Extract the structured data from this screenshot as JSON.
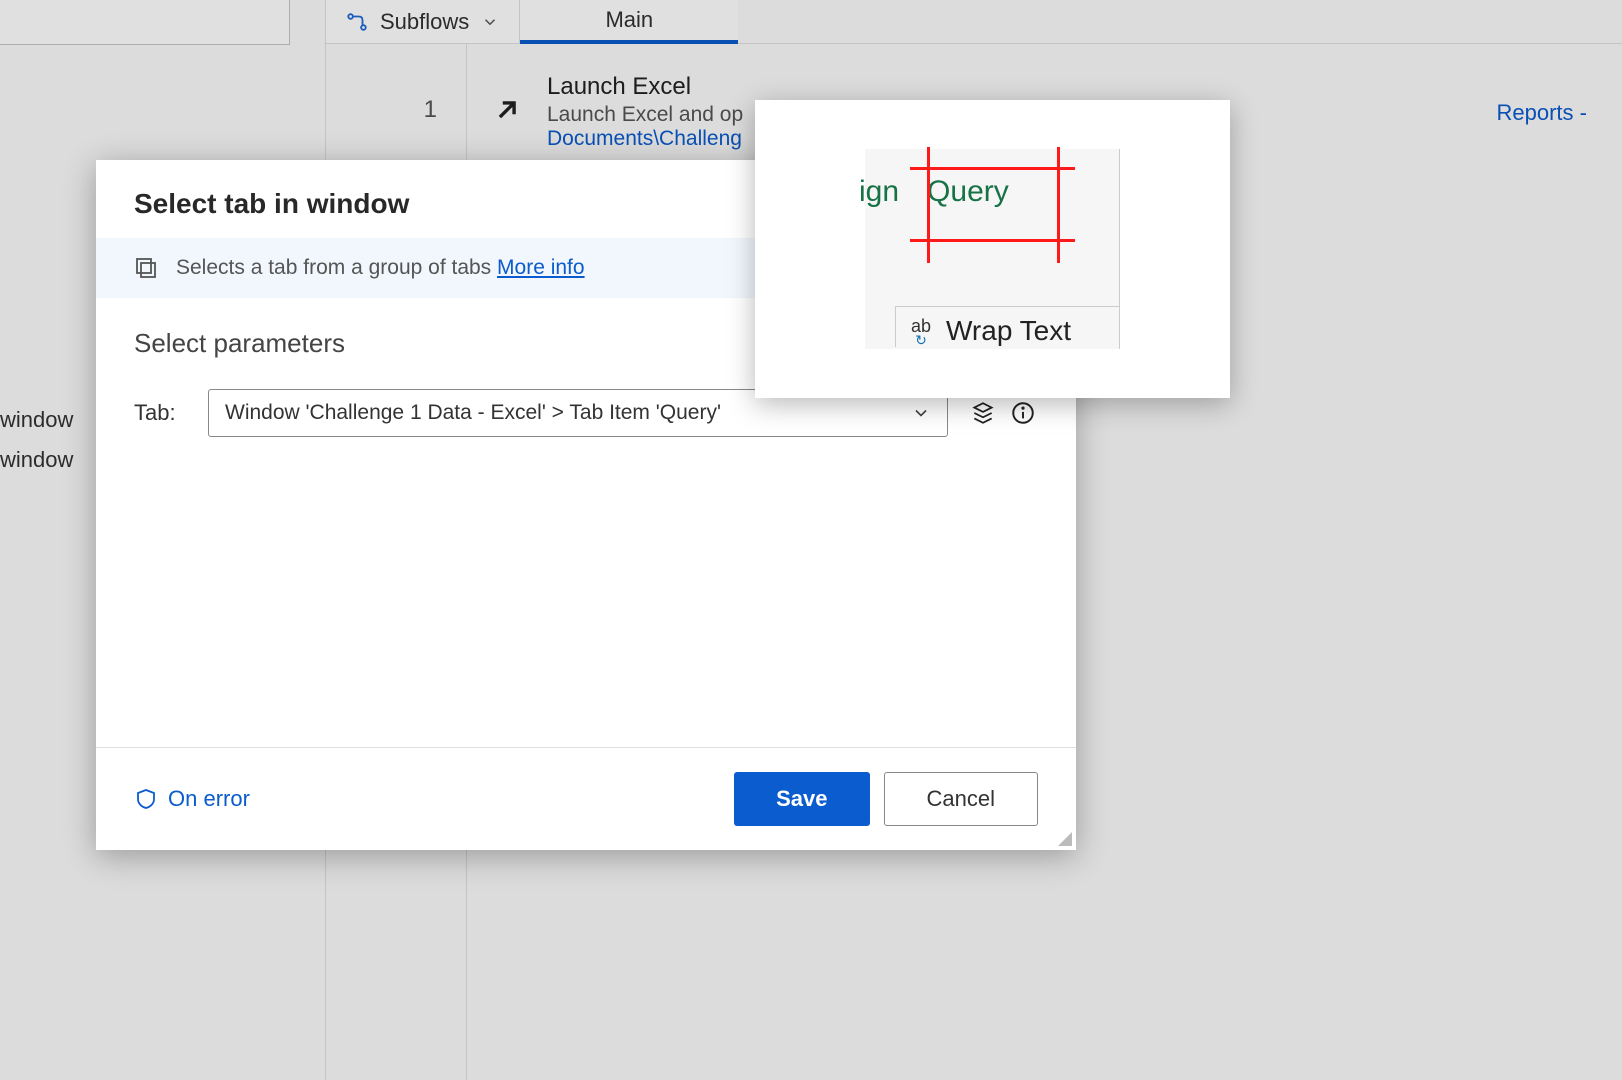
{
  "toolbar": {
    "subflows_label": "Subflows",
    "main_tab_label": "Main"
  },
  "step": {
    "number": "1",
    "title": "Launch Excel",
    "desc": "Launch Excel and op",
    "path": "Documents\\Challeng",
    "reports_link": "Reports -"
  },
  "side": {
    "line1": "window",
    "line2": "window"
  },
  "dialog": {
    "title": "Select tab in window",
    "description": "Selects a tab from a group of tabs",
    "more_info": "More info",
    "section_header": "Select parameters",
    "param_label": "Tab:",
    "param_value": "Window 'Challenge 1 Data - Excel' > Tab Item 'Query'",
    "on_error_label": "On error",
    "save_label": "Save",
    "cancel_label": "Cancel"
  },
  "preview": {
    "tab_partial": "ign",
    "tab_highlighted": "Query",
    "wrap_text_label": "Wrap Text",
    "wrap_icon_text": "ab"
  }
}
